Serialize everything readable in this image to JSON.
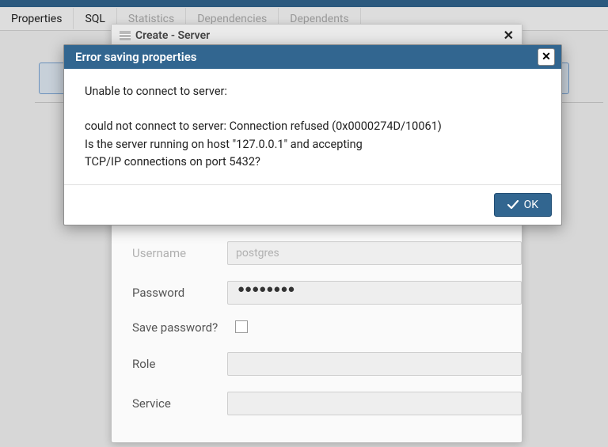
{
  "tabs": {
    "properties": "Properties",
    "sql": "SQL",
    "statistics": "Statistics",
    "dependencies": "Dependencies",
    "dependents": "Dependents"
  },
  "create_dialog": {
    "title": "Create - Server",
    "form": {
      "username_label": "Username",
      "username_value": "postgres",
      "password_label": "Password",
      "password_mask": "●●●●●●●●",
      "savepw_label": "Save password?",
      "role_label": "Role",
      "role_value": "",
      "service_label": "Service",
      "service_value": ""
    }
  },
  "error_dialog": {
    "title": "Error saving properties",
    "line0": "Unable to connect to server:",
    "line1": "could not connect to server: Connection refused (0x0000274D/10061)",
    "line2": "Is the server running on host \"127.0.0.1\" and accepting",
    "line3": "TCP/IP connections on port 5432?",
    "ok_label": "OK"
  }
}
